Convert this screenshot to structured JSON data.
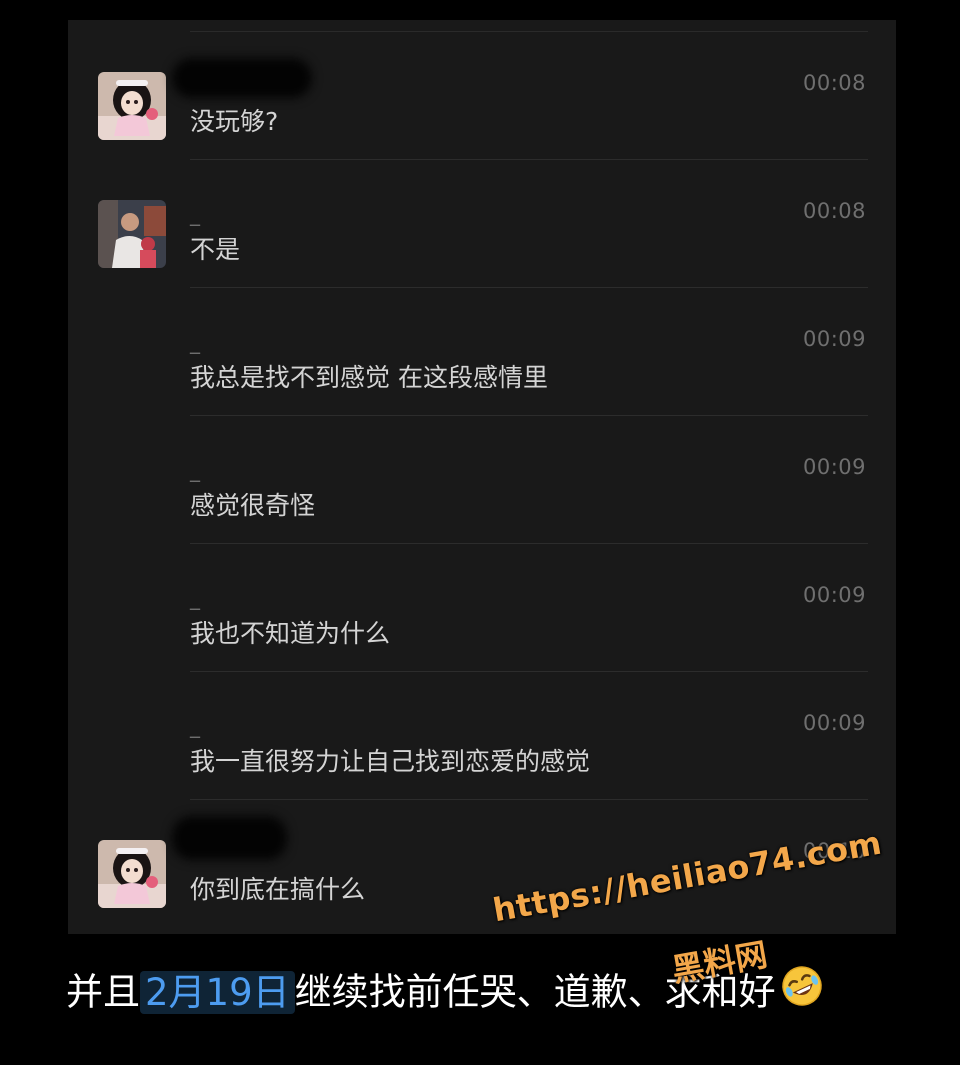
{
  "messages": [
    {
      "id": "m1",
      "sender": "",
      "time": "00:08",
      "text": "没玩够?",
      "avatar": "avatar-girl",
      "redacted": true
    },
    {
      "id": "m2",
      "sender": "_",
      "time": "00:08",
      "text": "不是",
      "avatar": "avatar-photo",
      "redacted": false
    },
    {
      "id": "m3",
      "sender": "_",
      "time": "00:09",
      "text": "我总是找不到感觉 在这段感情里",
      "avatar": null,
      "redacted": false
    },
    {
      "id": "m4",
      "sender": "_",
      "time": "00:09",
      "text": "感觉很奇怪",
      "avatar": null,
      "redacted": false
    },
    {
      "id": "m5",
      "sender": "_",
      "time": "00:09",
      "text": "我也不知道为什么",
      "avatar": null,
      "redacted": false
    },
    {
      "id": "m6",
      "sender": "_",
      "time": "00:09",
      "text": "我一直很努力让自己找到恋爱的感觉",
      "avatar": null,
      "redacted": false
    },
    {
      "id": "m7",
      "sender": "",
      "time": "00:10",
      "text": "你到底在搞什么",
      "avatar": "avatar-girl",
      "redacted": true
    }
  ],
  "caption": {
    "before": "并且",
    "highlight": "2月19日",
    "after": "继续找前任哭、道歉、求和好",
    "emoji": "rofl-emoji"
  },
  "watermark": {
    "url": "https://heiliao74.com",
    "name": "黑料网"
  },
  "colors": {
    "background": "#000000",
    "panel": "#191919",
    "message_text": "#d4d4d4",
    "time_text": "#6f6f6f",
    "highlight_text": "#4d9cf0",
    "watermark": "#f3a74a"
  }
}
